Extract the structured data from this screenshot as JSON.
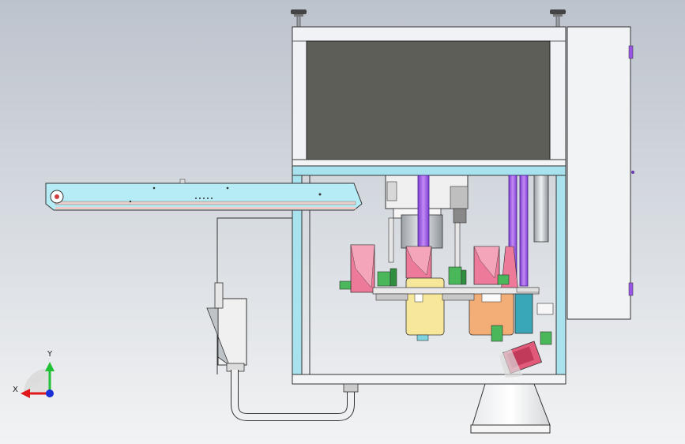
{
  "triad": {
    "x_label": "X",
    "y_label": "Y"
  },
  "colors": {
    "frame": "#a8e2ee",
    "panel": "#f0f2f5",
    "screen": "#5d5e58",
    "cylinder_purple": "#9b55e6",
    "block_pink": "#ee7a9a",
    "block_yellow": "#f6e79a",
    "block_orange": "#f3ad77",
    "teal": "#3aa7b8",
    "green": "#4ab85a",
    "axis_x": "#e0181c",
    "axis_y": "#22c035",
    "axis_z": "#1a2fd8"
  }
}
